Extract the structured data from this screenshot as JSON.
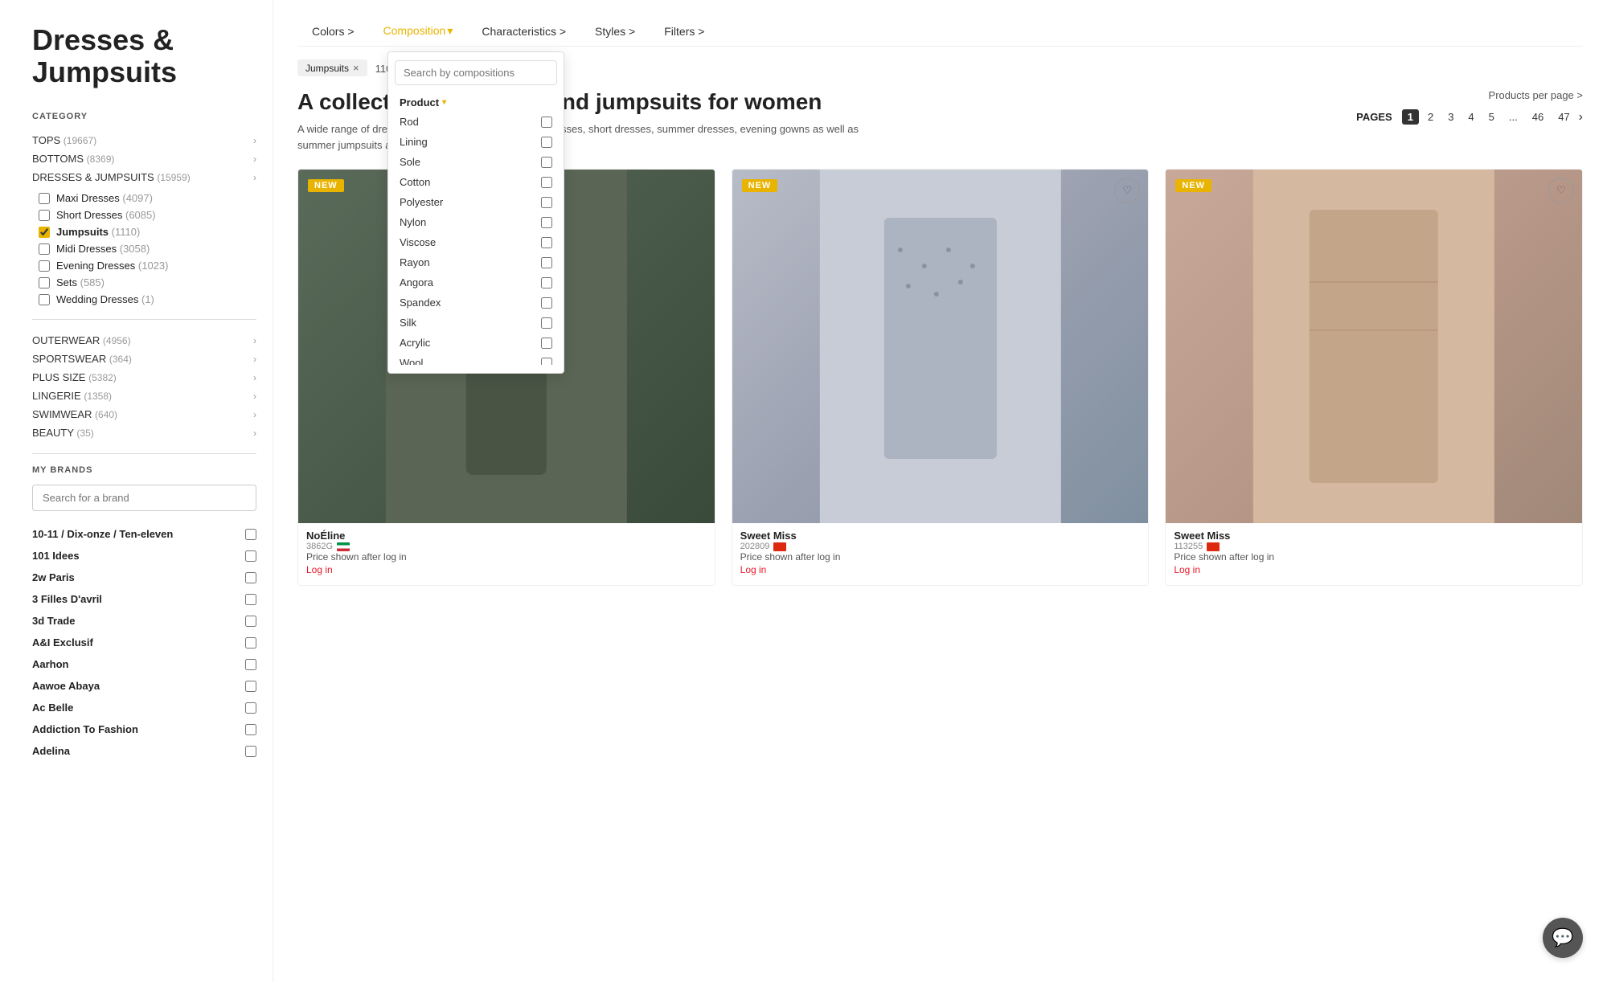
{
  "page": {
    "title_line1": "Dresses &",
    "title_line2": "Jumpsuits"
  },
  "sidebar": {
    "category_label": "CATEGORY",
    "categories": [
      {
        "id": "tops",
        "label": "TOPS",
        "count": "19667",
        "hasArrow": true
      },
      {
        "id": "bottoms",
        "label": "BOTTOMS",
        "count": "8369",
        "hasArrow": true
      },
      {
        "id": "dresses-jumpsuits",
        "label": "DRESSES & JUMPSUITS",
        "count": "15959",
        "hasArrow": true
      }
    ],
    "subcategories": [
      {
        "id": "maxi-dresses",
        "label": "Maxi Dresses",
        "count": "4097",
        "checked": false
      },
      {
        "id": "short-dresses",
        "label": "Short Dresses",
        "count": "6085",
        "checked": false
      },
      {
        "id": "jumpsuits",
        "label": "Jumpsuits",
        "count": "1110",
        "checked": true
      },
      {
        "id": "midi-dresses",
        "label": "Midi Dresses",
        "count": "3058",
        "checked": false
      },
      {
        "id": "evening-dresses",
        "label": "Evening Dresses",
        "count": "1023",
        "checked": false
      },
      {
        "id": "sets",
        "label": "Sets",
        "count": "585",
        "checked": false
      },
      {
        "id": "wedding-dresses",
        "label": "Wedding Dresses",
        "count": "1",
        "checked": false
      }
    ],
    "outerwear": {
      "label": "OUTERWEAR",
      "count": "4956"
    },
    "sportswear": {
      "label": "SPORTSWEAR",
      "count": "364"
    },
    "plus_size": {
      "label": "PLUS SIZE",
      "count": "5382"
    },
    "lingerie": {
      "label": "LINGERIE",
      "count": "1358"
    },
    "swimwear": {
      "label": "SWIMWEAR",
      "count": "640"
    },
    "beauty": {
      "label": "BEAUTY",
      "count": "35"
    },
    "my_brands_label": "MY BRANDS",
    "brand_search_placeholder": "Search for a brand",
    "brands": [
      "10-11 / Dix-onze / Ten-eleven",
      "101 Idees",
      "2w Paris",
      "3 Filles D'avril",
      "3d Trade",
      "A&I Exclusif",
      "Aarhon",
      "Aawoe Abaya",
      "Ac Belle",
      "Addiction To Fashion",
      "Adelina"
    ]
  },
  "filter_nav": {
    "colors_label": "Colors >",
    "composition_label": "Composition",
    "composition_caret": "▾",
    "characteristics_label": "Characteristics >",
    "styles_label": "Styles >",
    "filters_label": "Filters >"
  },
  "active_tag": "Jumpsuits",
  "active_tag_close": "×",
  "results_count": "1106 FOUND ITEMS",
  "seo": {
    "heading": "A collection of dresses and jumpsuits for women",
    "text": "A wide range of dresses, jumpsuits, tunics. Find maxi dresses, short dresses, summer dresses, evening gowns as well as summer jumpsuits and rompers in eFashion online."
  },
  "products_per_page": "Products per page >",
  "pagination": {
    "label": "PAGES",
    "pages": [
      "1",
      "2",
      "3",
      "4",
      "5",
      "...",
      "46",
      "47"
    ],
    "current": "1",
    "next_arrow": "›"
  },
  "composition_dropdown": {
    "search_placeholder": "Search by compositions",
    "section_label": "Product",
    "section_caret": "▾",
    "items": [
      "Rod",
      "Lining",
      "Sole",
      "Cotton",
      "Polyester",
      "Nylon",
      "Viscose",
      "Rayon",
      "Angora",
      "Spandex",
      "Silk",
      "Acrylic",
      "Wool"
    ]
  },
  "products": [
    {
      "id": "p1",
      "brand": "NoÉline",
      "code": "3862G",
      "flag": "it",
      "price_label": "Price shown after log in",
      "log_in": "Log in",
      "is_new": true,
      "img_class": "product-img-1",
      "wishlist": false
    },
    {
      "id": "p2",
      "brand": "Sweet Miss",
      "code": "202809",
      "flag": "cn",
      "price_label": "Price shown after log in",
      "log_in": "Log in",
      "is_new": true,
      "img_class": "product-img-2",
      "wishlist": false
    },
    {
      "id": "p3",
      "brand": "Sweet Miss",
      "code": "113255",
      "flag": "cn",
      "price_label": "Price shown after log in",
      "log_in": "Log in",
      "is_new": true,
      "img_class": "product-img-3",
      "wishlist": false
    }
  ],
  "chat_icon": "💬"
}
